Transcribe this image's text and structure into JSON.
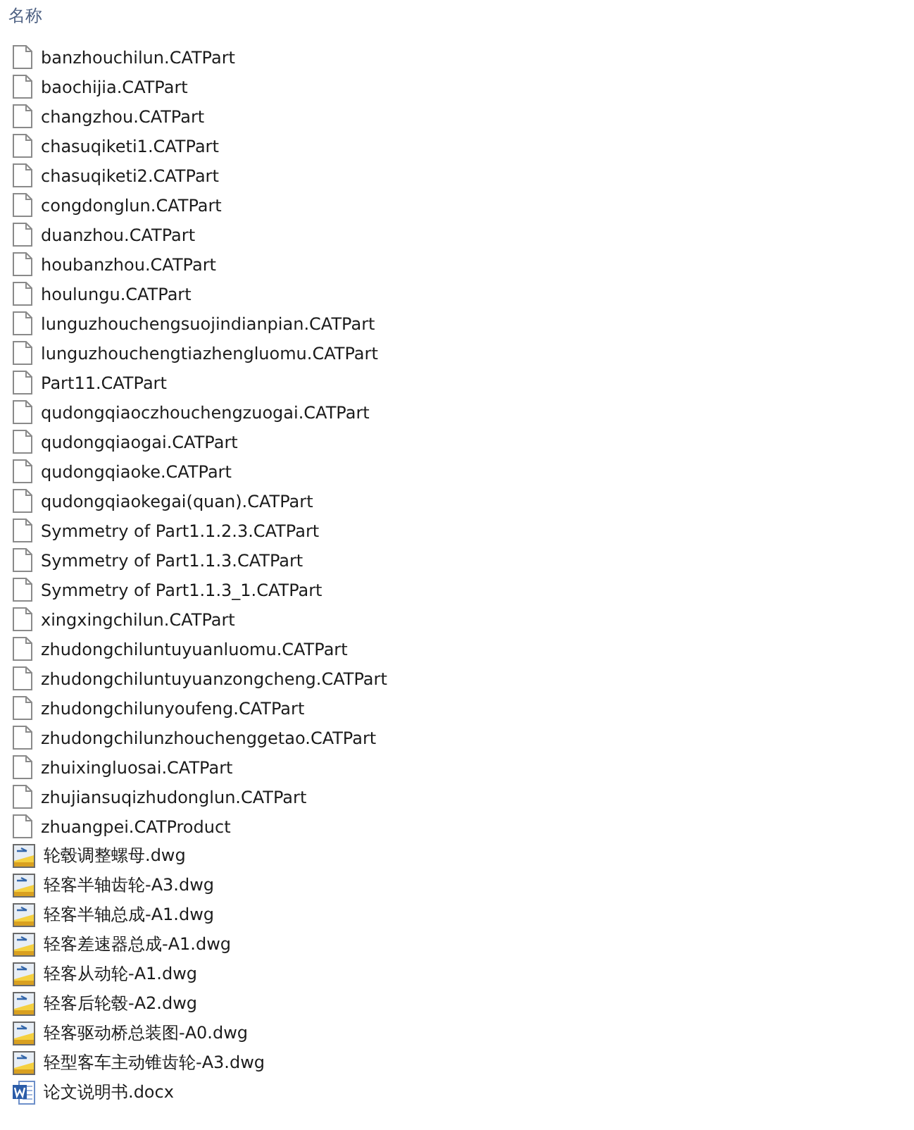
{
  "column_header": "名称",
  "files": [
    {
      "name": "banzhouchilun.CATPart",
      "kind": "blank"
    },
    {
      "name": "baochijia.CATPart",
      "kind": "blank"
    },
    {
      "name": "changzhou.CATPart",
      "kind": "blank"
    },
    {
      "name": "chasuqiketi1.CATPart",
      "kind": "blank"
    },
    {
      "name": "chasuqiketi2.CATPart",
      "kind": "blank"
    },
    {
      "name": "congdonglun.CATPart",
      "kind": "blank"
    },
    {
      "name": "duanzhou.CATPart",
      "kind": "blank"
    },
    {
      "name": "houbanzhou.CATPart",
      "kind": "blank"
    },
    {
      "name": "houlungu.CATPart",
      "kind": "blank"
    },
    {
      "name": "lunguzhouchengsuojindianpian.CATPart",
      "kind": "blank"
    },
    {
      "name": "lunguzhouchengtiazhengluomu.CATPart",
      "kind": "blank"
    },
    {
      "name": "Part11.CATPart",
      "kind": "blank"
    },
    {
      "name": "qudongqiaoczhouchengzuogai.CATPart",
      "kind": "blank"
    },
    {
      "name": "qudongqiaogai.CATPart",
      "kind": "blank"
    },
    {
      "name": "qudongqiaoke.CATPart",
      "kind": "blank"
    },
    {
      "name": "qudongqiaokegai(quan).CATPart",
      "kind": "blank"
    },
    {
      "name": "Symmetry of Part1.1.2.3.CATPart",
      "kind": "blank"
    },
    {
      "name": "Symmetry of Part1.1.3.CATPart",
      "kind": "blank"
    },
    {
      "name": "Symmetry of Part1.1.3_1.CATPart",
      "kind": "blank"
    },
    {
      "name": "xingxingchilun.CATPart",
      "kind": "blank"
    },
    {
      "name": "zhudongchiluntuyuanluomu.CATPart",
      "kind": "blank"
    },
    {
      "name": "zhudongchiluntuyuanzongcheng.CATPart",
      "kind": "blank"
    },
    {
      "name": "zhudongchilunyoufeng.CATPart",
      "kind": "blank"
    },
    {
      "name": "zhudongchilunzhouchenggetao.CATPart",
      "kind": "blank"
    },
    {
      "name": "zhuixingluosai.CATPart",
      "kind": "blank"
    },
    {
      "name": "zhujiansuqizhudonglun.CATPart",
      "kind": "blank"
    },
    {
      "name": "zhuangpei.CATProduct",
      "kind": "blank"
    },
    {
      "name": "轮毂调整螺母.dwg",
      "kind": "dwg"
    },
    {
      "name": "轻客半轴齿轮-A3.dwg",
      "kind": "dwg"
    },
    {
      "name": "轻客半轴总成-A1.dwg",
      "kind": "dwg"
    },
    {
      "name": "轻客差速器总成-A1.dwg",
      "kind": "dwg"
    },
    {
      "name": "轻客从动轮-A1.dwg",
      "kind": "dwg"
    },
    {
      "name": "轻客后轮毂-A2.dwg",
      "kind": "dwg"
    },
    {
      "name": "轻客驱动桥总装图-A0.dwg",
      "kind": "dwg"
    },
    {
      "name": "轻型客车主动锥齿轮-A3.dwg",
      "kind": "dwg"
    },
    {
      "name": "论文说明书.docx",
      "kind": "docx"
    }
  ]
}
